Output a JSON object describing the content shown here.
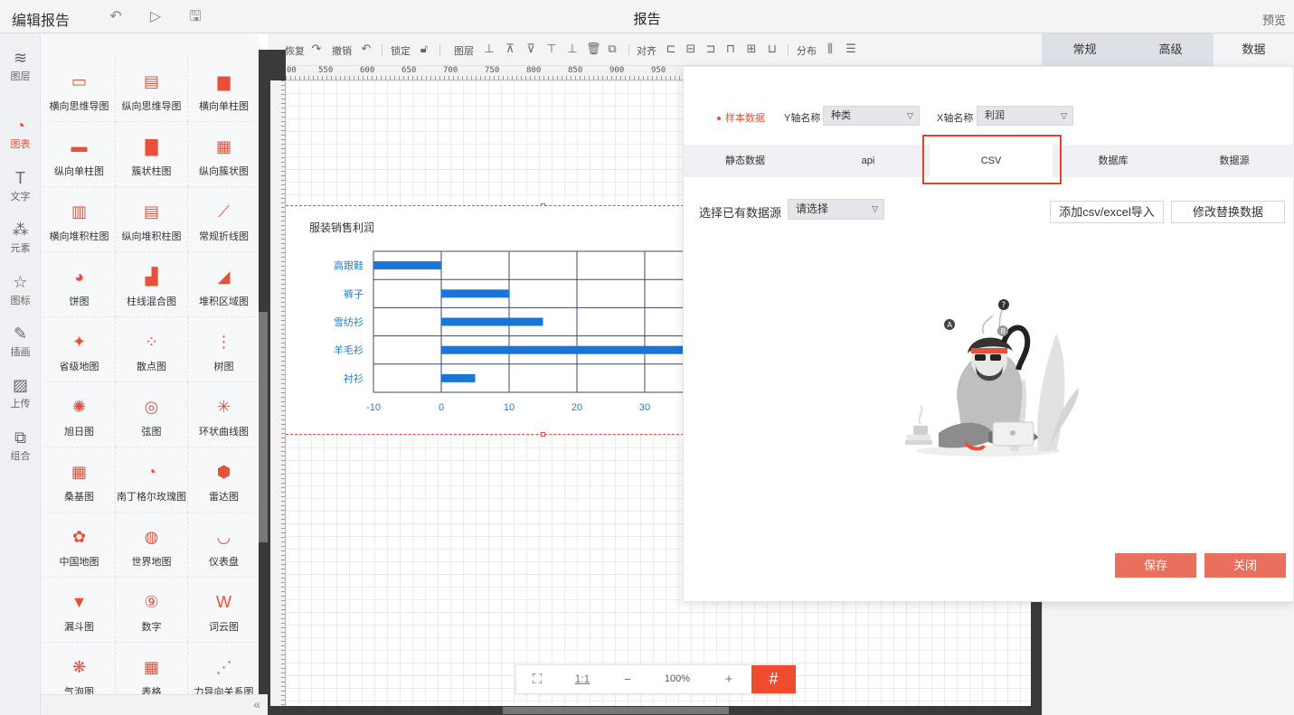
{
  "header": {
    "app_title": "编辑报告",
    "doc_title": "报告",
    "preview_label": "预览"
  },
  "rail": {
    "items": [
      {
        "label": "图层",
        "icon": "layers-icon"
      },
      {
        "label": "图表",
        "icon": "chart-pie-icon",
        "active": true
      },
      {
        "label": "文字",
        "icon": "text-icon"
      },
      {
        "label": "元素",
        "icon": "elements-icon"
      },
      {
        "label": "图标",
        "icon": "star-icon"
      },
      {
        "label": "插画",
        "icon": "palette-icon"
      },
      {
        "label": "上传",
        "icon": "image-upload-icon"
      },
      {
        "label": "组合",
        "icon": "group-icon"
      }
    ]
  },
  "palette": {
    "items": [
      "横向思维导图",
      "纵向思维导图",
      "横向单柱图",
      "纵向单柱图",
      "簇状柱图",
      "纵向簇状图",
      "横向堆积柱图",
      "纵向堆积柱图",
      "常规折线图",
      "饼图",
      "柱线混合图",
      "堆积区域图",
      "省级地图",
      "散点图",
      "树图",
      "旭日图",
      "弦图",
      "环状曲线图",
      "桑基图",
      "南丁格尔玫瑰图",
      "雷达图",
      "中国地图",
      "世界地图",
      "仪表盘",
      "漏斗图",
      "数字",
      "词云图",
      "气泡图",
      "表格",
      "力导向关系图"
    ],
    "collapse_icon": "double-chevron-left-icon"
  },
  "toolbar": {
    "redo": "恢复",
    "undo": "撤销",
    "lock": "锁定",
    "layer": "图层",
    "align": "对齐",
    "distribute": "分布"
  },
  "ruler": {
    "top_ticks": [
      "00",
      "550",
      "600",
      "650",
      "700",
      "750",
      "800",
      "850",
      "900",
      "950"
    ]
  },
  "chart": {
    "title": "服装销售利润"
  },
  "chart_data": {
    "type": "bar",
    "orientation": "horizontal",
    "title": "服装销售利润",
    "categories": [
      "高跟鞋",
      "裤子",
      "雪纺衫",
      "羊毛衫",
      "衬衫"
    ],
    "values": [
      -10,
      10,
      15,
      36,
      5
    ],
    "x_ticks": [
      -10,
      0,
      10,
      20,
      30
    ],
    "xlim": [
      -10,
      40
    ],
    "grid": true,
    "bar_color": "#1a75d9"
  },
  "zoom": {
    "fit_label": "⛶",
    "ratio_label": "1:1",
    "minus_label": "−",
    "zoom_value": "100%",
    "plus_label": "+",
    "grid_label": "#"
  },
  "right_tabs": {
    "general": "常规",
    "advanced": "高级",
    "data": "数据"
  },
  "modal": {
    "sample_label": "样本数据",
    "y_axis_label": "Y轴名称",
    "y_axis_value": "种类",
    "x_axis_label": "X轴名称",
    "x_axis_value": "利润",
    "tabs": [
      "静态数据",
      "api",
      "CSV",
      "数据库",
      "数据源"
    ],
    "active_tab": "CSV",
    "datasource_label": "选择已有数据源",
    "datasource_placeholder": "请选择",
    "add_csv_label": "添加csv/excel导入",
    "replace_label": "修改替换数据",
    "save_label": "保存",
    "close_label": "关闭"
  },
  "colors": {
    "accent": "#e8503a",
    "action_button": "#e9705c",
    "bar": "#1a75d9",
    "grid_button": "#f04b2f"
  }
}
